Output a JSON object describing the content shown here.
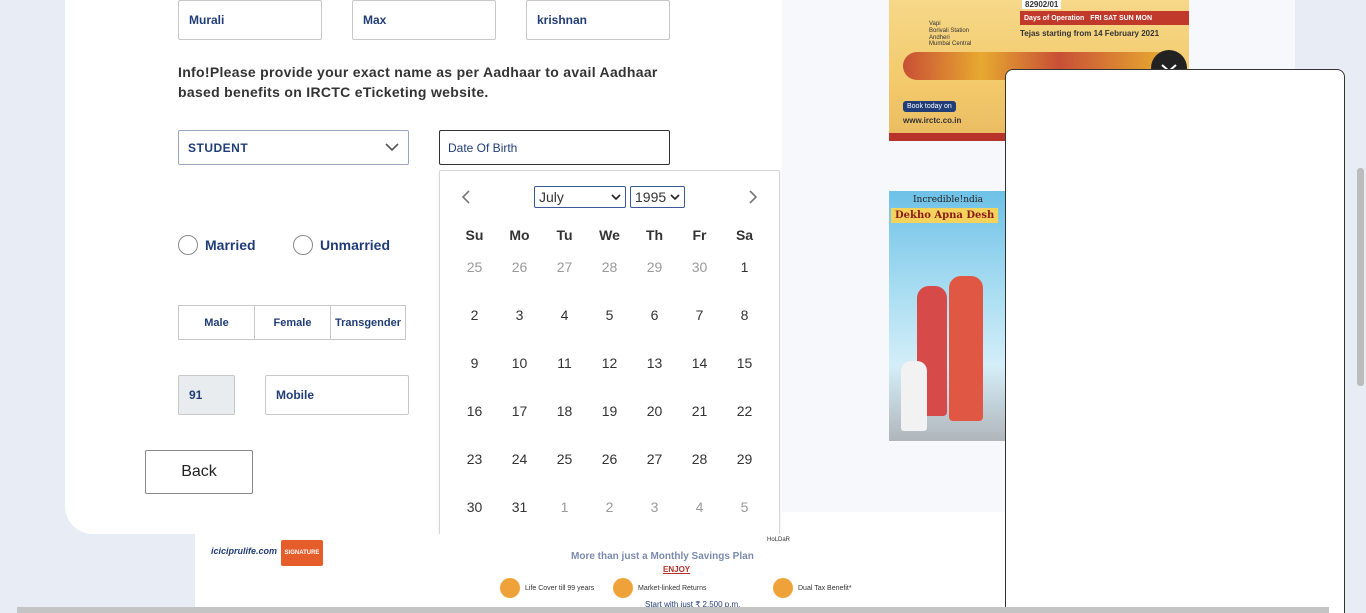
{
  "form": {
    "first_name": "Murali",
    "middle_name": "Max",
    "last_name": "krishnan",
    "info_text": "Info!Please provide your exact name as per Aadhaar to avail Aadhaar based benefits on IRCTC eTicketing website.",
    "occupation": "STUDENT",
    "dob_placeholder": "Date Of Birth",
    "marital": [
      "Married",
      "Unmarried"
    ],
    "gender": [
      "Male",
      "Female",
      "Transgender"
    ],
    "country_code": "91",
    "mobile_placeholder": "Mobile",
    "back_label": "Back"
  },
  "calendar": {
    "month": "July",
    "year": "1995",
    "weekdays": [
      "Su",
      "Mo",
      "Tu",
      "We",
      "Th",
      "Fr",
      "Sa"
    ],
    "weeks": [
      [
        {
          "d": "25",
          "m": true
        },
        {
          "d": "26",
          "m": true
        },
        {
          "d": "27",
          "m": true
        },
        {
          "d": "28",
          "m": true
        },
        {
          "d": "29",
          "m": true
        },
        {
          "d": "30",
          "m": true
        },
        {
          "d": "1",
          "m": false
        }
      ],
      [
        {
          "d": "2",
          "m": false
        },
        {
          "d": "3",
          "m": false
        },
        {
          "d": "4",
          "m": false
        },
        {
          "d": "5",
          "m": false
        },
        {
          "d": "6",
          "m": false
        },
        {
          "d": "7",
          "m": false
        },
        {
          "d": "8",
          "m": false
        }
      ],
      [
        {
          "d": "9",
          "m": false
        },
        {
          "d": "10",
          "m": false
        },
        {
          "d": "11",
          "m": false
        },
        {
          "d": "12",
          "m": false
        },
        {
          "d": "13",
          "m": false
        },
        {
          "d": "14",
          "m": false
        },
        {
          "d": "15",
          "m": false
        }
      ],
      [
        {
          "d": "16",
          "m": false
        },
        {
          "d": "17",
          "m": false
        },
        {
          "d": "18",
          "m": false
        },
        {
          "d": "19",
          "m": false
        },
        {
          "d": "20",
          "m": false
        },
        {
          "d": "21",
          "m": false
        },
        {
          "d": "22",
          "m": false
        }
      ],
      [
        {
          "d": "23",
          "m": false
        },
        {
          "d": "24",
          "m": false
        },
        {
          "d": "25",
          "m": false
        },
        {
          "d": "26",
          "m": false
        },
        {
          "d": "27",
          "m": false
        },
        {
          "d": "28",
          "m": false
        },
        {
          "d": "29",
          "m": false
        }
      ],
      [
        {
          "d": "30",
          "m": false
        },
        {
          "d": "31",
          "m": false
        },
        {
          "d": "1",
          "m": true
        },
        {
          "d": "2",
          "m": true
        },
        {
          "d": "3",
          "m": true
        },
        {
          "d": "4",
          "m": true
        },
        {
          "d": "5",
          "m": true
        }
      ]
    ]
  },
  "ads": {
    "tejas": {
      "station_code": "82902/01",
      "days_label": "Days of Operation",
      "days": "FRI  SAT  SUN  MON",
      "station1": "Vapi",
      "station2": "Borivali Station",
      "station3": "Andheri",
      "station4": "Mumbai Central",
      "start_text": "Tejas starting from 14 February 2021",
      "book": "Book today on",
      "url": "www.irctc.co.in"
    },
    "incredible": {
      "brand": "Incredible!ndia",
      "tagline": "Dekho Apna Desh"
    },
    "icici": {
      "logo": "iciciprulife.com",
      "badge": "SIGNATURE",
      "headline": "More than just a Monthly Savings Plan",
      "enjoy": "ENJOY",
      "features": [
        "Life Cover till 99 years",
        "Market-linked Returns",
        "Dual Tax Benefit*"
      ],
      "start": "Start with just ₹ 2,500 p.m.",
      "corner": "HoLDaR"
    }
  },
  "colors": {
    "brand": "#213d77",
    "page_bg": "#e8edf5"
  }
}
